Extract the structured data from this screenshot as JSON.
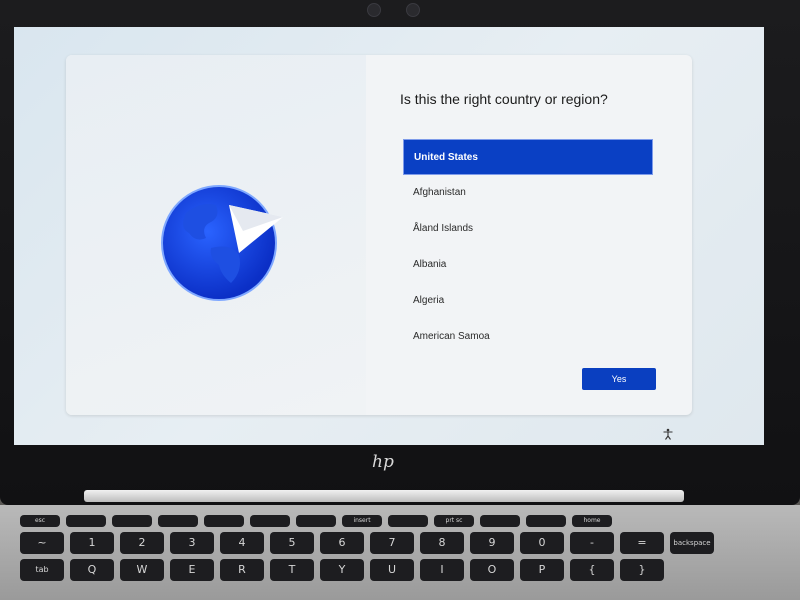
{
  "oobe": {
    "title": "Is this the right country or region?",
    "countries": [
      {
        "label": "United States",
        "selected": true
      },
      {
        "label": "Afghanistan",
        "selected": false
      },
      {
        "label": "Åland Islands",
        "selected": false
      },
      {
        "label": "Albania",
        "selected": false
      },
      {
        "label": "Algeria",
        "selected": false
      },
      {
        "label": "American Samoa",
        "selected": false
      }
    ],
    "yes_label": "Yes",
    "illustration_icon": "globe-with-paper-plane-icon",
    "accessibility_icon": "accessibility-icon"
  },
  "hardware": {
    "brand_logo_text": "hp",
    "keyboard_rows": [
      [
        "~",
        "1",
        "2",
        "3",
        "4",
        "5",
        "6",
        "7",
        "8",
        "9",
        "0",
        "-",
        "=",
        "backspace"
      ],
      [
        "tab",
        "Q",
        "W",
        "E",
        "R",
        "T",
        "Y",
        "U",
        "I",
        "O",
        "P",
        "{",
        "}"
      ]
    ],
    "function_row": [
      "esc",
      "",
      "",
      "",
      "",
      "",
      "",
      "insert",
      "",
      "prt sc",
      "",
      "",
      "home"
    ]
  },
  "colors": {
    "accent": "#0a40c4",
    "screen_bg": "#e3ebf1",
    "card_bg": "#f2f4f6"
  }
}
